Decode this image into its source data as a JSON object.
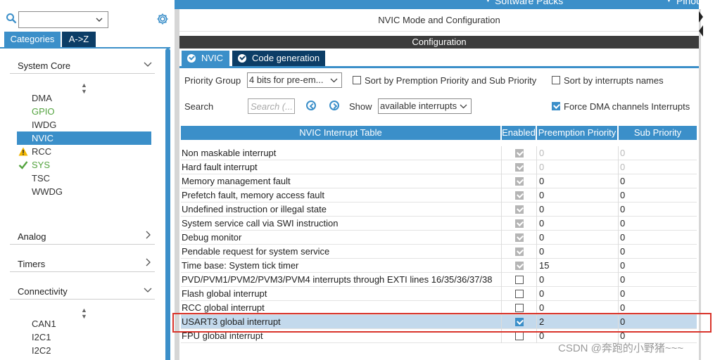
{
  "sidebar": {
    "search": {
      "value": ""
    },
    "tabs": {
      "categories": "Categories",
      "atoz": "A->Z"
    },
    "groups": [
      {
        "label": "System Core",
        "expanded": true,
        "items": [
          {
            "label": "DMA",
            "state": "none"
          },
          {
            "label": "GPIO",
            "state": "configured"
          },
          {
            "label": "IWDG",
            "state": "none"
          },
          {
            "label": "NVIC",
            "state": "selected"
          },
          {
            "label": "RCC",
            "state": "warning"
          },
          {
            "label": "SYS",
            "state": "ok"
          },
          {
            "label": "TSC",
            "state": "none"
          },
          {
            "label": "WWDG",
            "state": "none"
          }
        ]
      },
      {
        "label": "Analog",
        "expanded": false
      },
      {
        "label": "Timers",
        "expanded": false
      },
      {
        "label": "Connectivity",
        "expanded": true,
        "items": [
          {
            "label": "CAN1"
          },
          {
            "label": "I2C1"
          },
          {
            "label": "I2C2"
          }
        ]
      }
    ]
  },
  "header": {
    "software_packs": "Software Packs",
    "pinout": "Pinout",
    "mode_title": "NVIC Mode and Configuration",
    "configuration": "Configuration"
  },
  "tabs": {
    "nvic": "NVIC",
    "code_generation": "Code generation"
  },
  "controls": {
    "priority_group_label": "Priority Group",
    "priority_group_value": "4 bits for pre-em...",
    "sort_premption_label": "Sort by Premption Priority and Sub Priority",
    "sort_premption_checked": false,
    "sort_names_label": "Sort by interrupts names",
    "sort_names_checked": false,
    "search_label": "Search",
    "search_placeholder": "Search (...",
    "show_label": "Show",
    "show_value": "available interrupts",
    "force_dma_label": "Force DMA channels Interrupts",
    "force_dma_checked": true
  },
  "table": {
    "headers": {
      "name": "NVIC Interrupt Table",
      "enabled": "Enabled",
      "preemption": "Preemption Priority",
      "sub": "Sub Priority"
    },
    "rows": [
      {
        "name": "Non maskable interrupt",
        "enabled": "locked",
        "pp": "0",
        "sp": "0",
        "muted": true
      },
      {
        "name": "Hard fault interrupt",
        "enabled": "locked",
        "pp": "0",
        "sp": "0",
        "muted": true
      },
      {
        "name": "Memory management fault",
        "enabled": "locked",
        "pp": "0",
        "sp": "0"
      },
      {
        "name": "Prefetch fault, memory access fault",
        "enabled": "locked",
        "pp": "0",
        "sp": "0"
      },
      {
        "name": "Undefined instruction or illegal state",
        "enabled": "locked",
        "pp": "0",
        "sp": "0"
      },
      {
        "name": "System service call via SWI instruction",
        "enabled": "locked",
        "pp": "0",
        "sp": "0"
      },
      {
        "name": "Debug monitor",
        "enabled": "locked",
        "pp": "0",
        "sp": "0"
      },
      {
        "name": "Pendable request for system service",
        "enabled": "locked",
        "pp": "0",
        "sp": "0"
      },
      {
        "name": "Time base: System tick timer",
        "enabled": "locked",
        "pp": "15",
        "sp": "0"
      },
      {
        "name": "PVD/PVM1/PVM2/PVM3/PVM4 interrupts through EXTI lines 16/35/36/37/38",
        "enabled": "off",
        "pp": "0",
        "sp": "0"
      },
      {
        "name": "Flash global interrupt",
        "enabled": "off",
        "pp": "0",
        "sp": "0"
      },
      {
        "name": "RCC global interrupt",
        "enabled": "off",
        "pp": "0",
        "sp": "0"
      },
      {
        "name": "USART3 global interrupt",
        "enabled": "on",
        "pp": "2",
        "sp": "0",
        "selected": true
      },
      {
        "name": "FPU global interrupt",
        "enabled": "off",
        "pp": "0",
        "sp": "0"
      }
    ]
  },
  "watermark": "CSDN @奔跑的小野猪~~~",
  "colors": {
    "accent": "#3b8fc9",
    "dark_tab": "#0c3d66",
    "config_bar": "#3c3c3c",
    "highlight": "#d9342b",
    "configured_green": "#53a33e"
  }
}
